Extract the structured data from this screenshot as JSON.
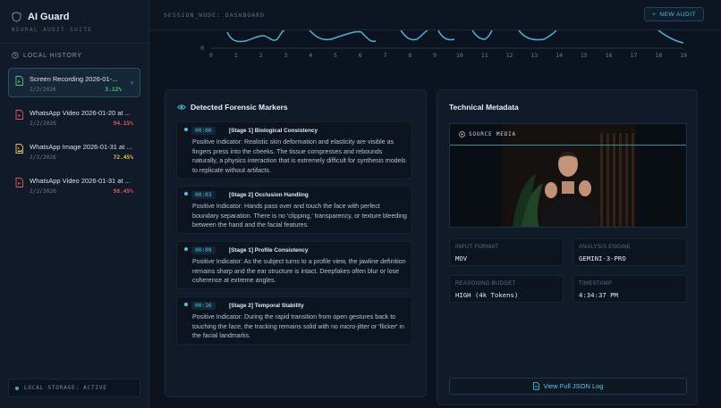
{
  "app": {
    "title": "AI Guard",
    "subtitle": "NEURAL AUDIT SUITE"
  },
  "history": {
    "heading": "LOCAL HISTORY",
    "items": [
      {
        "name": "Screen Recording 2026-01-...",
        "date": "2/2/2026",
        "score": "3.12%",
        "icon": "file-video-icon",
        "color": "#4cc46f"
      },
      {
        "name": "WhatsApp Video 2026-01-20 at ...",
        "date": "2/2/2026",
        "score": "94.15%",
        "icon": "file-video-icon",
        "color": "#e0575b"
      },
      {
        "name": "WhatsApp Image 2026-01-31 at ...",
        "date": "2/2/2026",
        "score": "72.45%",
        "icon": "file-image-icon",
        "color": "#e4c54a"
      },
      {
        "name": "WhatsApp Video 2026-01-31 at ...",
        "date": "2/2/2026",
        "score": "98.45%",
        "icon": "file-video-icon",
        "color": "#e0575b"
      }
    ]
  },
  "storage": {
    "label": "LOCAL STORAGE: ACTIVE"
  },
  "header": {
    "session": "SESSION_NODE: DASHBOARD",
    "new_audit": "NEW AUDIT"
  },
  "chart_data": {
    "type": "line",
    "x": [
      0,
      1,
      2,
      3,
      4,
      5,
      6,
      7,
      8,
      9,
      10,
      11,
      12,
      13,
      14,
      15,
      16,
      17,
      18,
      19
    ],
    "y_tick": "0",
    "color": "#4fb3cf"
  },
  "markers": {
    "title": "Detected Forensic Markers",
    "items": [
      {
        "time": "00:00",
        "stage": "[Stage 1] Biological Consistency",
        "text": "Positive Indicator: Realistic skin deformation and elasticity are visible as fingers press into the cheeks. The tissue compresses and rebounds naturally, a physics interaction that is extremely difficult for synthesis models to replicate without artifacts."
      },
      {
        "time": "00:03",
        "stage": "[Stage 2] Occlusion Handling",
        "text": "Positive Indicator: Hands pass over and touch the face with perfect boundary separation. There is no 'clipping,' transparency, or texture bleeding between the hand and the facial features."
      },
      {
        "time": "00:09",
        "stage": "[Stage 1] Profile Consistency",
        "text": "Positive Indicator: As the subject turns to a profile view, the jawline definition remains sharp and the ear structure is intact. Deepfakes often blur or lose coherence at extreme angles."
      },
      {
        "time": "00:16",
        "stage": "[Stage 2] Temporal Stability",
        "text": "Positive Indicator: During the rapid transition from open gestures back to touching the face, the tracking remains solid with no micro-jitter or 'flicker' in the facial landmarks."
      }
    ]
  },
  "metadata": {
    "title": "Technical Metadata",
    "media_label": "SOURCE MEDIA",
    "fields": [
      {
        "label": "INPUT FORMAT",
        "value": "MOV"
      },
      {
        "label": "ANALYSIS ENGINE",
        "value": "GEMINI-3-PRO"
      },
      {
        "label": "REASONING BUDGET",
        "value": "HIGH (4k Tokens)"
      },
      {
        "label": "TIMESTAMP",
        "value": "4:34:37 PM"
      }
    ],
    "json_button": "View Full JSON Log"
  }
}
